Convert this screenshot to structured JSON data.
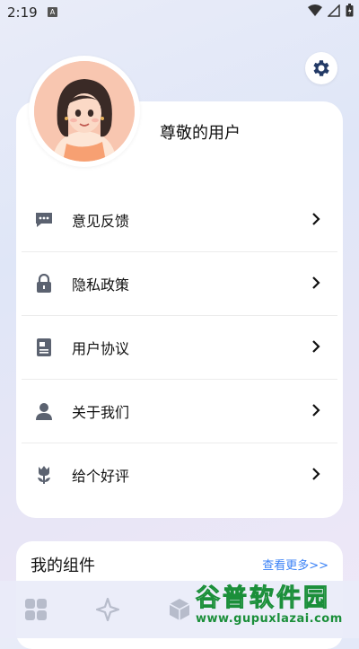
{
  "status": {
    "time": "2:19",
    "notif_glyph": "A"
  },
  "header": {
    "settings_icon": "gear-icon"
  },
  "profile": {
    "username": "尊敬的用户"
  },
  "menu": {
    "items": [
      {
        "label": "意见反馈",
        "icon": "chat-bubble-icon"
      },
      {
        "label": "隐私政策",
        "icon": "lock-icon"
      },
      {
        "label": "用户协议",
        "icon": "document-icon"
      },
      {
        "label": "关于我们",
        "icon": "person-icon"
      },
      {
        "label": "给个好评",
        "icon": "tulip-icon"
      }
    ]
  },
  "widgets": {
    "title": "我的组件",
    "more": "查看更多>>"
  },
  "watermark": {
    "top": "谷普软件园",
    "bottom": "www.gupuxlazai.com"
  },
  "colors": {
    "accent": "#3b82f6",
    "icon": "#5b6270",
    "watermark_green": "#1b8f3a"
  }
}
